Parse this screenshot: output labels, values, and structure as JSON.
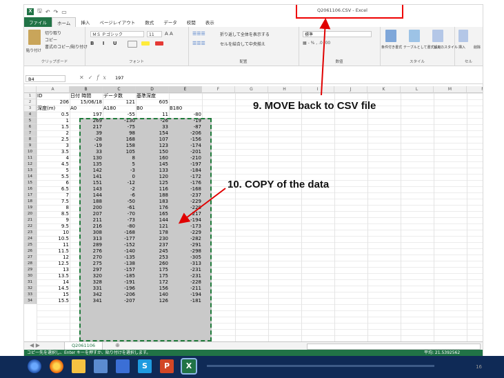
{
  "window": {
    "title": "Q2061106.CSV - Excel"
  },
  "ribbon": {
    "tabs": [
      "ファイル",
      "ホーム",
      "挿入",
      "ページレイアウト",
      "数式",
      "データ",
      "校閲",
      "表示"
    ],
    "clipboard": {
      "cut": "切り取り",
      "copy": "コピー",
      "format_painter": "書式のコピー/貼り付け",
      "paste": "貼り付け",
      "label": "クリップボード"
    },
    "font": {
      "name": "ＭＳ Ｐゴシック",
      "size": "11",
      "label": "フォント"
    },
    "alignment": {
      "wrap": "折り返して全体を表示する",
      "merge": "セルを結合して中央揃え",
      "label": "配置"
    },
    "number": {
      "format": "標準",
      "label": "数値"
    },
    "styles": {
      "conditional": "条件付き書式",
      "table": "テーブルとして書式設定",
      "cell": "セルのスタイル",
      "label": "スタイル"
    },
    "cells": {
      "insert": "挿入",
      "delete": "削除",
      "label": "セル"
    }
  },
  "formula_bar": {
    "name_box": "B4",
    "value": "197"
  },
  "grid": {
    "columns": [
      "A",
      "B",
      "C",
      "D",
      "E",
      "F",
      "G",
      "H",
      "I",
      "J",
      "K",
      "L",
      "M",
      "N"
    ],
    "rows": [
      [
        "1",
        "ID",
        "日付 時間",
        "データ数",
        "基準深度",
        ""
      ],
      [
        "2",
        "206",
        "15/06/18",
        "121",
        "605",
        ""
      ],
      [
        "3",
        "深度(m)",
        "A0",
        "A180",
        "B0",
        "B180"
      ],
      [
        "4",
        "0.5",
        "197",
        "-55",
        "11",
        "-80"
      ],
      [
        "5",
        "1",
        "269",
        "-130",
        "-26",
        "-19"
      ],
      [
        "6",
        "1.5",
        "217",
        "-75",
        "33",
        "-87"
      ],
      [
        "7",
        "2",
        "39",
        "98",
        "154",
        "-206"
      ],
      [
        "8",
        "2.5",
        "-28",
        "168",
        "107",
        "-156"
      ],
      [
        "9",
        "3",
        "-19",
        "158",
        "123",
        "-174"
      ],
      [
        "10",
        "3.5",
        "33",
        "105",
        "150",
        "-201"
      ],
      [
        "11",
        "4",
        "130",
        "8",
        "160",
        "-210"
      ],
      [
        "12",
        "4.5",
        "135",
        "5",
        "145",
        "-197"
      ],
      [
        "13",
        "5",
        "142",
        "-3",
        "133",
        "-184"
      ],
      [
        "14",
        "5.5",
        "141",
        "0",
        "120",
        "-172"
      ],
      [
        "15",
        "6",
        "151",
        "-12",
        "125",
        "-176"
      ],
      [
        "16",
        "6.5",
        "143",
        "-2",
        "116",
        "-168"
      ],
      [
        "17",
        "7",
        "144",
        "-6",
        "188",
        "-237"
      ],
      [
        "18",
        "7.5",
        "188",
        "-50",
        "183",
        "-229"
      ],
      [
        "19",
        "8",
        "200",
        "-61",
        "176",
        "-228"
      ],
      [
        "20",
        "8.5",
        "207",
        "-70",
        "165",
        "-217"
      ],
      [
        "21",
        "9",
        "211",
        "-73",
        "144",
        "-194"
      ],
      [
        "22",
        "9.5",
        "216",
        "-80",
        "121",
        "-173"
      ],
      [
        "23",
        "10",
        "308",
        "-168",
        "178",
        "-229"
      ],
      [
        "24",
        "10.5",
        "313",
        "-177",
        "230",
        "-282"
      ],
      [
        "25",
        "11",
        "289",
        "-152",
        "237",
        "-291"
      ],
      [
        "26",
        "11.5",
        "276",
        "-140",
        "245",
        "-298"
      ],
      [
        "27",
        "12",
        "270",
        "-135",
        "253",
        "-305"
      ],
      [
        "28",
        "12.5",
        "275",
        "-138",
        "260",
        "-313"
      ],
      [
        "29",
        "13",
        "297",
        "-157",
        "175",
        "-231"
      ],
      [
        "30",
        "13.5",
        "320",
        "-185",
        "175",
        "-231"
      ],
      [
        "31",
        "14",
        "328",
        "-191",
        "172",
        "-228"
      ],
      [
        "32",
        "14.5",
        "331",
        "-196",
        "156",
        "-211"
      ],
      [
        "33",
        "15",
        "342",
        "-206",
        "140",
        "-194"
      ],
      [
        "34",
        "15.5",
        "341",
        "-207",
        "126",
        "-181"
      ]
    ]
  },
  "sheet": {
    "tab_name": "Q2061106",
    "add_label": "⊕"
  },
  "status": {
    "message": "コピー先を選択し、Enter キーを押すか、貼り付けを選択します。",
    "average": "平均: 21.5392562"
  },
  "annotations": {
    "step9": "9. MOVE back to CSV file",
    "step10": "10. COPY of the data"
  },
  "slide_number": "16",
  "colors": {
    "excel_green": "#217346",
    "annotation_red": "#e00000",
    "marquee": "#1f7a3a"
  }
}
